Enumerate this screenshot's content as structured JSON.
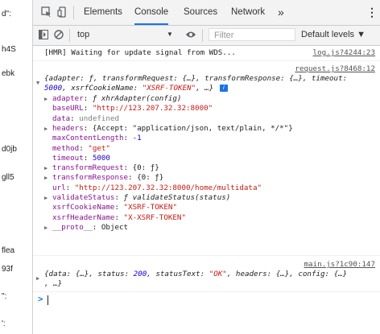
{
  "left_strip": [
    "d\":",
    "",
    "h4S",
    "ebk",
    "",
    "",
    "d0jb",
    "",
    "gll5",
    "",
    "",
    "",
    "flea",
    "93f",
    "\":",
    "':"
  ],
  "devtools": {
    "tabs": [
      "Elements",
      "Console",
      "Sources",
      "Network"
    ],
    "active_tab": "Console",
    "more_tabs": "»",
    "menu": "⋮"
  },
  "toolbar": {
    "context": "top",
    "filter_placeholder": "Filter",
    "levels": "Default levels ▼"
  },
  "console": {
    "msg1": {
      "text": "[HMR] Waiting for update signal from WDS...",
      "source": "log.js?4244:23"
    },
    "msg2": {
      "source": "request.js?8468:12",
      "summary_l1": "{adapter: ƒ, transformRequest: {…}, transformResponse: {…}, timeout:",
      "summary_l2_num": "5000",
      "summary_l2_key": ", xsrfCookieName: ",
      "summary_l2_str": "\"XSRF-TOKEN\"",
      "summary_l2_end": ", …}",
      "info": "i",
      "props": [
        {
          "key": "adapter",
          "val": "ƒ xhrAdapter(config)",
          "kind": "fn",
          "expand": true
        },
        {
          "key": "baseURL",
          "val": "\"http://123.207.32.32:8000\"",
          "kind": "str",
          "expand": false
        },
        {
          "key": "data",
          "val": "undefined",
          "kind": "und",
          "expand": false
        },
        {
          "key": "headers",
          "val": "{Accept: \"application/json, text/plain, */*\"}",
          "kind": "obj",
          "expand": true
        },
        {
          "key": "maxContentLength",
          "val": "-1",
          "kind": "num",
          "expand": false
        },
        {
          "key": "method",
          "val": "\"get\"",
          "kind": "str",
          "expand": false
        },
        {
          "key": "timeout",
          "val": "5000",
          "kind": "num",
          "expand": false
        },
        {
          "key": "transformRequest",
          "val": "{0: ƒ}",
          "kind": "obj",
          "expand": true
        },
        {
          "key": "transformResponse",
          "val": "{0: ƒ}",
          "kind": "obj",
          "expand": true
        },
        {
          "key": "url",
          "val": "\"http://123.207.32.32:8000/home/multidata\"",
          "kind": "str",
          "expand": false
        },
        {
          "key": "validateStatus",
          "val": "ƒ validateStatus(status)",
          "kind": "fn",
          "expand": true
        },
        {
          "key": "xsrfCookieName",
          "val": "\"XSRF-TOKEN\"",
          "kind": "str",
          "expand": false
        },
        {
          "key": "xsrfHeaderName",
          "val": "\"X-XSRF-TOKEN\"",
          "kind": "str",
          "expand": false
        },
        {
          "key": "__proto__",
          "val": "Object",
          "kind": "proto",
          "expand": true
        }
      ]
    },
    "msg3": {
      "source": "main.js?1c90:147",
      "l1a": "{data: {…}, status: ",
      "l1num": "200",
      "l1b": ", statusText: ",
      "l1str": "\"OK\"",
      "l1c": ", headers: {…}, config: {…}",
      "l2": ", …}"
    },
    "prompt": ">"
  }
}
